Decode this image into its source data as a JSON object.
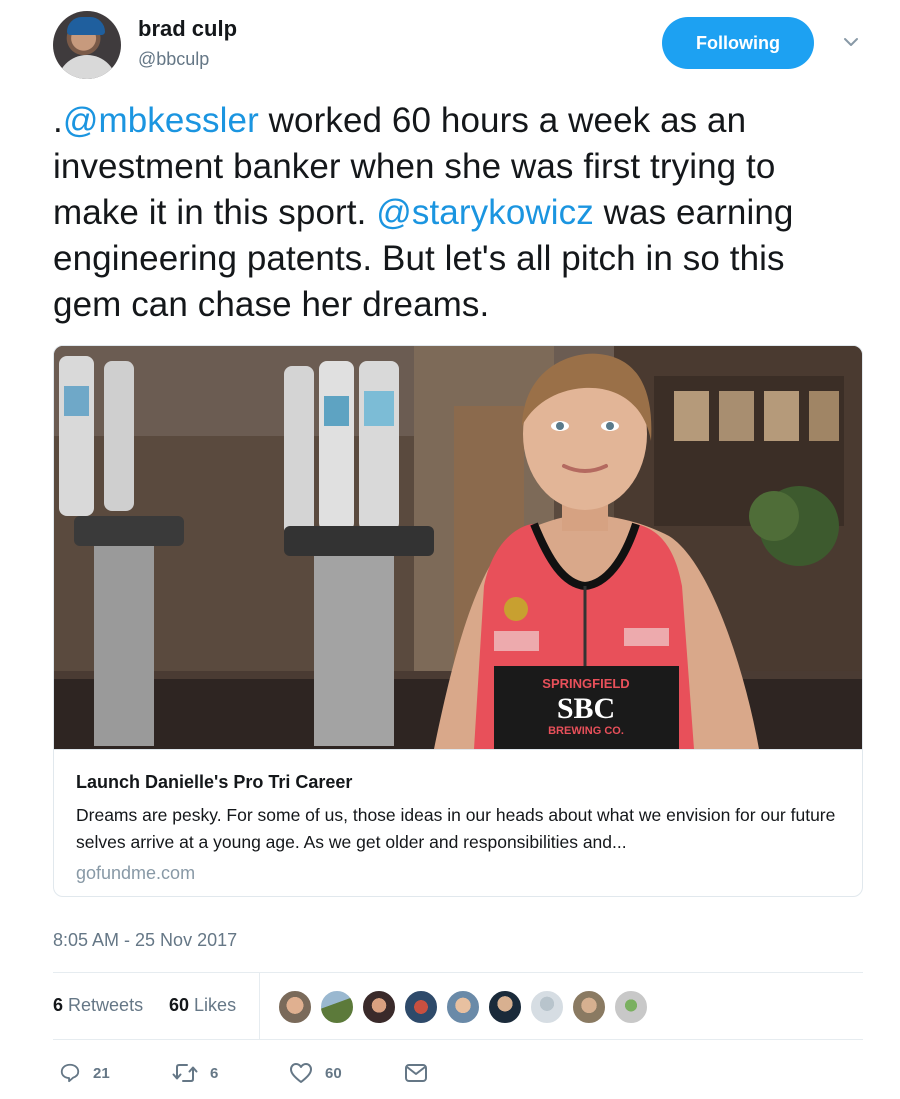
{
  "author": {
    "name": "brad culp",
    "handle": "@bbculp"
  },
  "follow_button": {
    "label": "Following"
  },
  "tweet": {
    "text_parts": [
      ".",
      "@mbkessler",
      " worked 60 hours a week as an investment banker when she was first trying to make it in this sport. ",
      "@starykowicz",
      " was earning engineering patents. But let's all pitch in so this gem can chase her dreams."
    ]
  },
  "card": {
    "title": "Launch Danielle's Pro Tri Career",
    "description": "Dreams are pesky. For some of us, those ideas in our heads about what we envision for our future selves arrive at a young age. As we get older and responsibilities and...",
    "domain": "gofundme.com",
    "jersey_text": {
      "top": "SPRINGFIELD",
      "middle": "SBC",
      "bottom": "BREWING CO."
    }
  },
  "timestamp": "8:05 AM - 25 Nov 2017",
  "stats": {
    "retweets_count": "6",
    "retweets_label": "Retweets",
    "likes_count": "60",
    "likes_label": "Likes"
  },
  "actions": {
    "reply_count": "21",
    "retweet_count": "6",
    "like_count": "60"
  },
  "colors": {
    "accent": "#1da1f2",
    "mention": "#1b95e0",
    "muted": "#657786"
  },
  "icons": [
    "chevron-down-icon",
    "reply-icon",
    "retweet-icon",
    "like-icon",
    "message-icon"
  ]
}
